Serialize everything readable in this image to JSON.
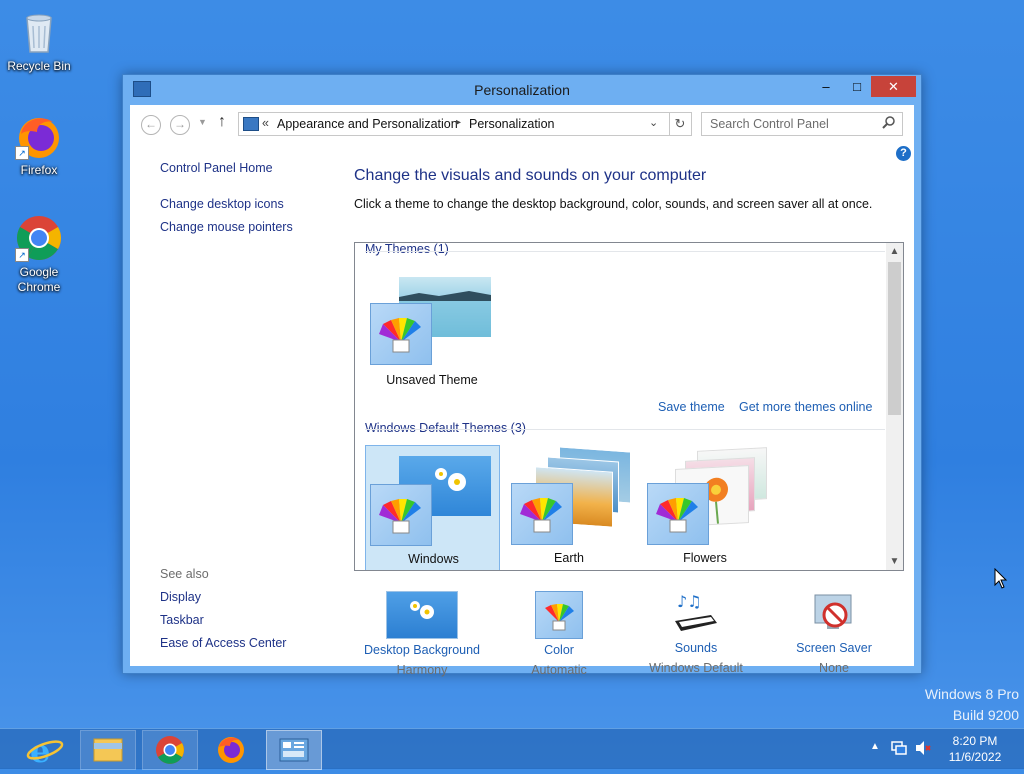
{
  "desktop": {
    "icons": [
      {
        "label": "Recycle Bin"
      },
      {
        "label": "Firefox"
      },
      {
        "label": "Google Chrome"
      }
    ],
    "watermark": {
      "line1": "Windows 8 Pro",
      "line2": "Build 9200"
    }
  },
  "window": {
    "title": "Personalization",
    "buttons": {
      "minimize": "–",
      "maximize": "□",
      "close": "✕"
    },
    "address": {
      "chevron": "«",
      "crumbs": [
        "Appearance and Personalization",
        "Personalization"
      ],
      "separator": "▸"
    },
    "search": {
      "placeholder": "Search Control Panel"
    },
    "help": "?",
    "left": {
      "home": "Control Panel Home",
      "links": [
        "Change desktop icons",
        "Change mouse pointers"
      ],
      "see_also_title": "See also",
      "see_also": [
        "Display",
        "Taskbar",
        "Ease of Access Center"
      ]
    },
    "main": {
      "heading": "Change the visuals and sounds on your computer",
      "subtitle": "Click a theme to change the desktop background, color, sounds, and screen saver all at once.",
      "my_themes_label": "My Themes (1)",
      "unsaved_theme": "Unsaved Theme",
      "save_theme": "Save theme",
      "get_more": "Get more themes online",
      "default_themes_label": "Windows Default Themes (3)",
      "default_themes": [
        "Windows",
        "Earth",
        "Flowers"
      ],
      "selected_theme": "Windows"
    },
    "bottom": [
      {
        "title": "Desktop Background",
        "value": "Harmony"
      },
      {
        "title": "Color",
        "value": "Automatic"
      },
      {
        "title": "Sounds",
        "value": "Windows Default"
      },
      {
        "title": "Screen Saver",
        "value": "None"
      }
    ]
  },
  "taskbar": {
    "apps": [
      "internet-explorer-icon",
      "file-explorer-icon",
      "chrome-icon",
      "firefox-icon",
      "control-panel-icon"
    ],
    "clock": {
      "time": "8:20 PM",
      "date": "11/6/2022"
    }
  }
}
